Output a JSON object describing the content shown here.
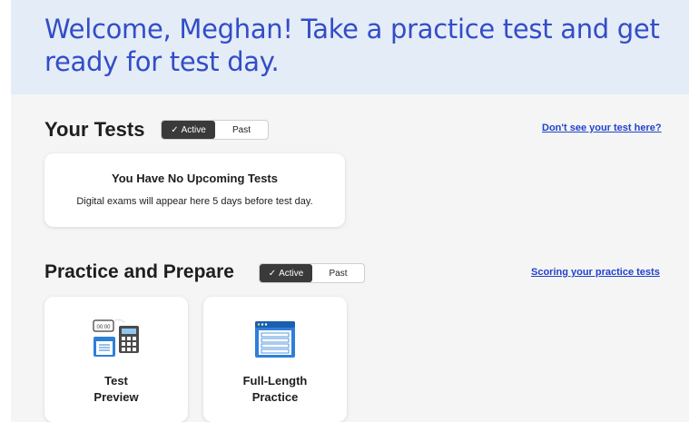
{
  "banner": {
    "welcome_text": "Welcome, Meghan! Take a practice test and get ready for test day."
  },
  "your_tests": {
    "title": "Your Tests",
    "toggle": {
      "active_label": "Active",
      "past_label": "Past",
      "selected": "Active"
    },
    "link": "Don't see your test here?",
    "empty_card": {
      "title": "You Have No Upcoming Tests",
      "description": "Digital exams will appear here 5 days before test day."
    }
  },
  "practice": {
    "title": "Practice and Prepare",
    "toggle": {
      "active_label": "Active",
      "past_label": "Past",
      "selected": "Active"
    },
    "link": "Scoring your practice tests",
    "tiles": [
      {
        "line1": "Test",
        "line2": "Preview",
        "icon": "timer-calculator-icon",
        "timer_text": "00:00"
      },
      {
        "line1": "Full-Length",
        "line2": "Practice",
        "icon": "test-window-icon"
      }
    ]
  },
  "colors": {
    "welcome_blue": "#324dc7",
    "banner_bg": "#e4ecf7",
    "link_blue": "#2142cc",
    "toggle_active_bg": "#3a3a3a"
  }
}
